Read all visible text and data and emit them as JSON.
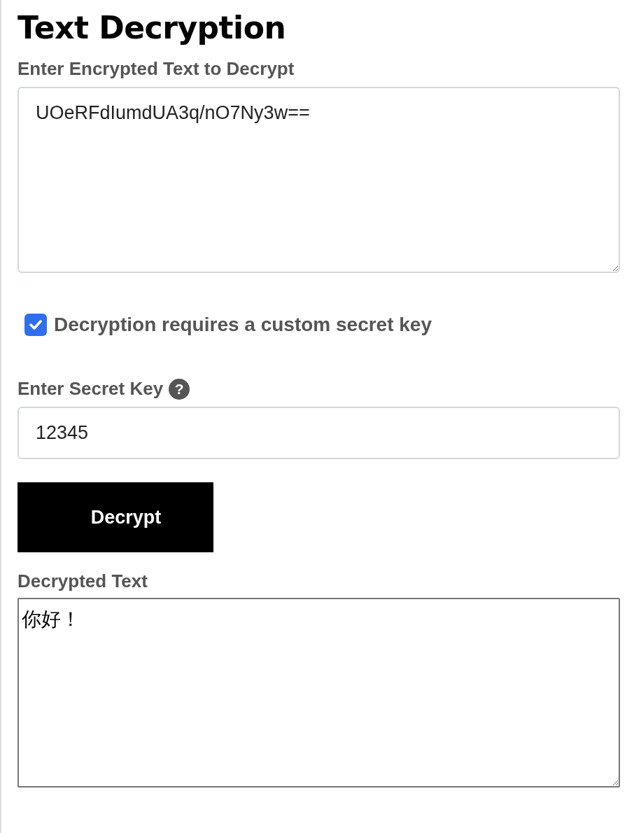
{
  "title": "Text Decryption",
  "input": {
    "label": "Enter Encrypted Text to Decrypt",
    "value": "UOeRFdIumdUA3q/nO7Ny3w=="
  },
  "custom_key": {
    "label": "Decryption requires a custom secret key",
    "checked": true
  },
  "secret_key": {
    "label": "Enter Secret Key",
    "help": "?",
    "value": "12345"
  },
  "button": "Decrypt",
  "output": {
    "label": "Decrypted Text",
    "value": "你好！"
  }
}
